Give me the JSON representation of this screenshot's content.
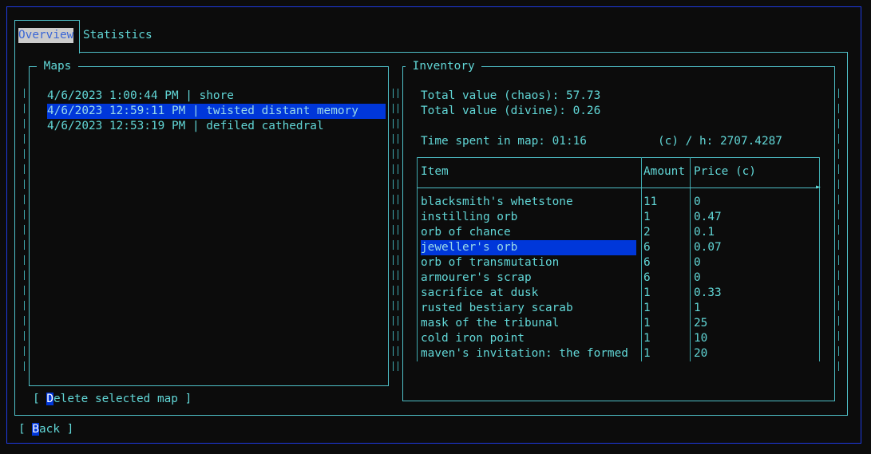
{
  "tabs": [
    {
      "label": "Overview",
      "selected": true
    },
    {
      "label": "Statistics",
      "selected": false
    }
  ],
  "maps_panel": {
    "title": "Maps",
    "entries": [
      "4/6/2023 1:00:44 PM | shore",
      "4/6/2023 12:59:11 PM | twisted distant memory",
      "4/6/2023 12:53:19 PM | defiled cathedral"
    ],
    "selected_index": 1,
    "delete_button": {
      "open": "[ ",
      "hotkey": "D",
      "rest": "elete selected map",
      "close": " ]"
    }
  },
  "inventory_panel": {
    "title": "Inventory",
    "total_chaos": "Total value (chaos): 57.73",
    "total_divine": "Total value (divine): 0.26",
    "time_spent": "Time spent in map: 01:16",
    "chaos_per_hour": "(c) / h: 2707.4287",
    "table": {
      "headers": [
        "Item",
        "Amount",
        "Price (c)"
      ],
      "selected_index": 3,
      "rows": [
        [
          "blacksmith's whetstone",
          "11",
          "0"
        ],
        [
          "instilling orb",
          "1",
          "0.47"
        ],
        [
          "orb of chance",
          "2",
          "0.1"
        ],
        [
          "jeweller's orb",
          "6",
          "0.07"
        ],
        [
          "orb of transmutation",
          "6",
          "0"
        ],
        [
          "armourer's scrap",
          "6",
          "0"
        ],
        [
          "sacrifice at dusk",
          "1",
          "0.33"
        ],
        [
          "rusted bestiary scarab",
          "1",
          "1"
        ],
        [
          "mask of the tribunal",
          "1",
          "25"
        ],
        [
          "cold iron point",
          "1",
          "10"
        ],
        [
          "maven's invitation: the formed",
          "1",
          "20"
        ]
      ]
    }
  },
  "back_button": {
    "open": "[ ",
    "hotkey": "B",
    "rest": "ack",
    "close": " ]"
  },
  "colors": {
    "background": "#0c0c0c",
    "text": "#61d6d6",
    "border": "#4fc0c8",
    "selection": "#0037da",
    "outer_border": "#1e3ae0"
  }
}
